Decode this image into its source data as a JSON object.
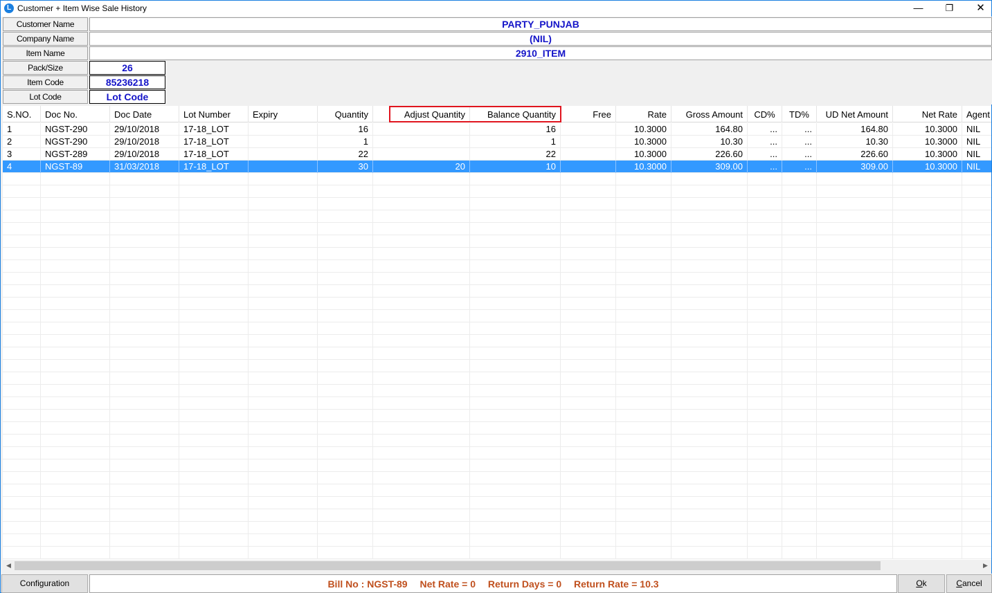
{
  "window": {
    "title": "Customer + Item Wise Sale History",
    "minimize": "—",
    "restore": "❐",
    "close": "✕"
  },
  "info": {
    "customer_name_label": "Customer Name",
    "customer_name": "PARTY_PUNJAB",
    "company_name_label": "Company Name",
    "company_name": "(NIL)",
    "item_name_label": "Item Name",
    "item_name": "2910_ITEM",
    "pack_size_label": "Pack/Size",
    "pack_size": "26",
    "item_code_label": "Item Code",
    "item_code": "85236218",
    "lot_code_label": "Lot Code",
    "lot_code": "Lot Code"
  },
  "columns": [
    "S.NO.",
    "Doc No.",
    "Doc Date",
    "Lot Number",
    "Expiry",
    "Quantity",
    "Adjust Quantity",
    "Balance Quantity",
    "Free",
    "Rate",
    "Gross Amount",
    "CD%",
    "TD%",
    "UD Net Amount",
    "Net Rate",
    "Agent"
  ],
  "rows": [
    [
      "1",
      "NGST-290",
      "29/10/2018",
      "17-18_LOT",
      "",
      "16",
      "",
      "16",
      "",
      "10.3000",
      "164.80",
      "...",
      "...",
      "164.80",
      "10.3000",
      "NIL"
    ],
    [
      "2",
      "NGST-290",
      "29/10/2018",
      "17-18_LOT",
      "",
      "1",
      "",
      "1",
      "",
      "10.3000",
      "10.30",
      "...",
      "...",
      "10.30",
      "10.3000",
      "NIL"
    ],
    [
      "3",
      "NGST-289",
      "29/10/2018",
      "17-18_LOT",
      "",
      "22",
      "",
      "22",
      "",
      "10.3000",
      "226.60",
      "...",
      "...",
      "226.60",
      "10.3000",
      "NIL"
    ],
    [
      "4",
      "NGST-89",
      "31/03/2018",
      "17-18_LOT",
      "",
      "30",
      "20",
      "10",
      "",
      "10.3000",
      "309.00",
      "...",
      "...",
      "309.00",
      "10.3000",
      "NIL"
    ]
  ],
  "selected_row": 4,
  "colors": {
    "selection": "#3399ff",
    "header_value_text": "#1414c8",
    "status_text": "#c0501e",
    "highlight_box": "#e0141e"
  },
  "status": {
    "bill_no": "Bill No : NGST-89",
    "net_rate": "Net Rate = 0",
    "return_days": "Return Days = 0",
    "return_rate": "Return Rate = 10.3"
  },
  "buttons": {
    "configuration": "Configuration",
    "ok": "Ok",
    "cancel": "Cancel"
  },
  "scrollbar": {
    "left_arrow": "◀",
    "right_arrow": "▶"
  }
}
